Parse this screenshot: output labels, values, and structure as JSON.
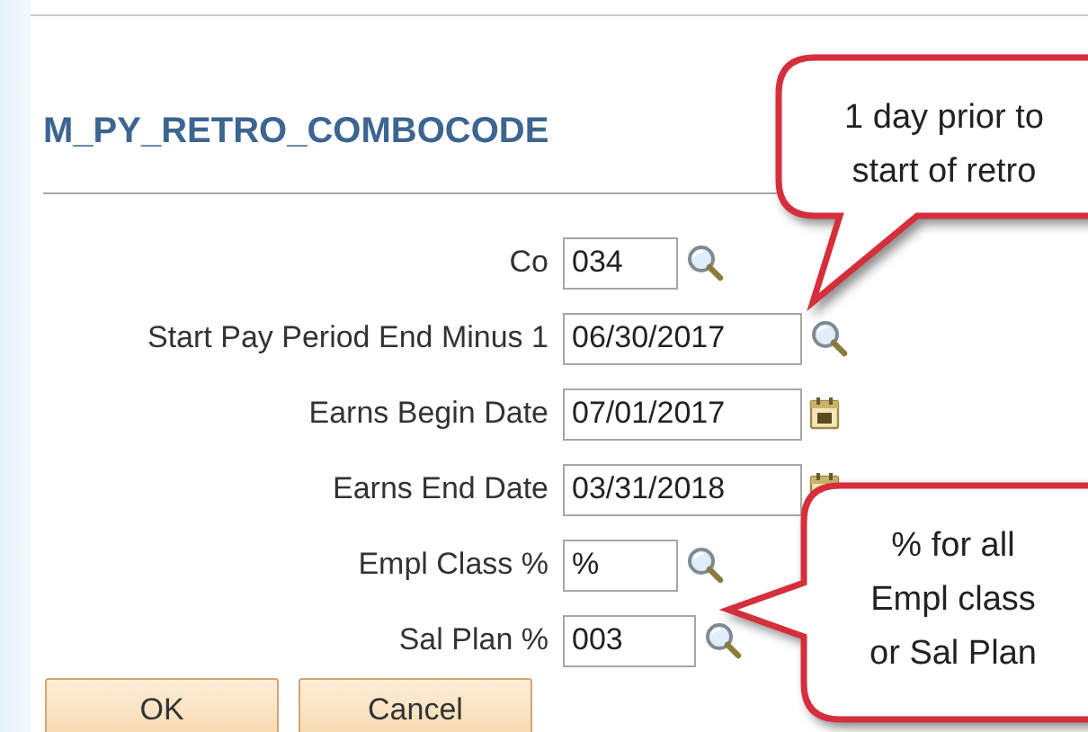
{
  "page": {
    "title": "M_PY_RETRO_COMBOCODE"
  },
  "fields": [
    {
      "label": "Co",
      "value": "034",
      "kind": "lookup"
    },
    {
      "label": "Start Pay Period End Minus 1",
      "value": "06/30/2017",
      "kind": "lookup"
    },
    {
      "label": "Earns Begin Date",
      "value": "07/01/2017",
      "kind": "calendar"
    },
    {
      "label": "Earns End Date",
      "value": "03/31/2018",
      "kind": "calendar"
    },
    {
      "label": "Empl Class %",
      "value": "%",
      "kind": "lookup"
    },
    {
      "label": "Sal Plan %",
      "value": "003",
      "kind": "lookup"
    }
  ],
  "buttons": [
    "OK",
    "Cancel"
  ],
  "callouts": [
    {
      "lines": [
        "1 day prior to",
        "start of retro"
      ]
    },
    {
      "lines": [
        "% for all",
        "Empl class",
        "or Sal Plan"
      ]
    }
  ]
}
